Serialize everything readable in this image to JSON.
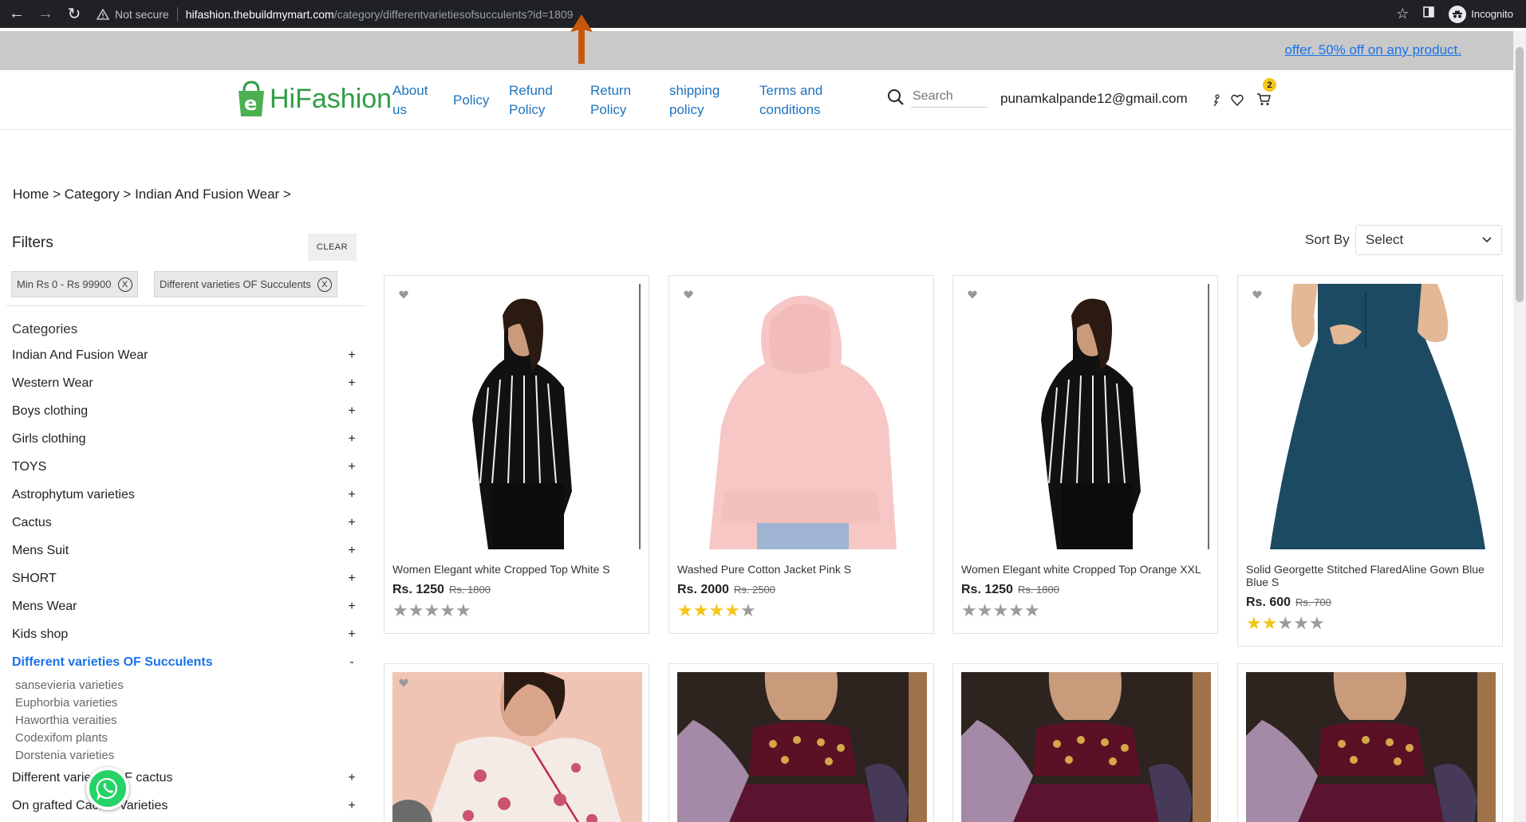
{
  "browser": {
    "security_label": "Not secure",
    "url_host": "hifashion.thebuildmymart.com",
    "url_path": "/category/differentvarietiesofsucculents?id=1809",
    "incognito_label": "Incognito"
  },
  "offer": {
    "text": "offer. 50% off on any product."
  },
  "header": {
    "logo_text": "HiFashion",
    "nav": [
      {
        "label": "About\nus"
      },
      {
        "label": "Policy"
      },
      {
        "label": "Refund\nPolicy"
      },
      {
        "label": "Return\nPolicy"
      },
      {
        "label": "shipping\npolicy"
      },
      {
        "label": "Terms and\nconditions"
      }
    ],
    "search_placeholder": "Search",
    "user_email": "punamkalpande12@gmail.com",
    "cart_count": "2"
  },
  "breadcrumb": "Home > Category > Indian And Fusion Wear >",
  "filters": {
    "title": "Filters",
    "clear_label": "CLEAR",
    "chips": [
      {
        "label": "Min Rs 0 - Rs 99900"
      },
      {
        "label": "Different varieties OF Succulents"
      }
    ],
    "categories_title": "Categories",
    "categories": [
      {
        "label": "Indian And Fusion Wear",
        "toggle": "+"
      },
      {
        "label": "Western Wear",
        "toggle": "+"
      },
      {
        "label": "Boys clothing",
        "toggle": "+"
      },
      {
        "label": "Girls clothing",
        "toggle": "+"
      },
      {
        "label": "TOYS",
        "toggle": "+"
      },
      {
        "label": "Astrophytum varieties",
        "toggle": "+"
      },
      {
        "label": "Cactus",
        "toggle": "+"
      },
      {
        "label": "Mens Suit",
        "toggle": "+"
      },
      {
        "label": "SHORT",
        "toggle": "+"
      },
      {
        "label": "Mens Wear",
        "toggle": "+"
      },
      {
        "label": "Kids shop",
        "toggle": "+"
      },
      {
        "label": "Different varieties OF Succulents",
        "toggle": "-"
      }
    ],
    "subcategories": [
      {
        "label": "sansevieria varieties"
      },
      {
        "label": "Euphorbia varieties"
      },
      {
        "label": "Haworthia veraities"
      },
      {
        "label": "Codexifom plants"
      },
      {
        "label": "Dorstenia varieties"
      }
    ],
    "more_categories": [
      {
        "label": "Different varieties OF cactus",
        "toggle": "+"
      },
      {
        "label": "On grafted Cactus Varieties",
        "toggle": "+"
      }
    ]
  },
  "sort": {
    "label": "Sort By",
    "value": "Select"
  },
  "products": [
    {
      "name": "Women Elegant white Cropped Top White S",
      "price": "Rs. 1250",
      "mrp": "Rs. 1800",
      "rating": 0
    },
    {
      "name": "Washed Pure Cotton Jacket Pink S",
      "price": "Rs. 2000",
      "mrp": "Rs. 2500",
      "rating": 4
    },
    {
      "name": "Women Elegant white Cropped Top Orange XXL",
      "price": "Rs. 1250",
      "mrp": "Rs. 1800",
      "rating": 0
    },
    {
      "name": "Solid Georgette Stitched FlaredAline Gown Blue Blue S",
      "price": "Rs. 600",
      "mrp": "Rs. 700",
      "rating": 2
    }
  ],
  "colors": {
    "accent_blue": "#1e73be",
    "link_blue": "#1a73e8",
    "brand_green": "#2f9e44",
    "star_yellow": "#f5c518",
    "offer_bar": "#c9c9c9",
    "chrome": "#202124"
  }
}
